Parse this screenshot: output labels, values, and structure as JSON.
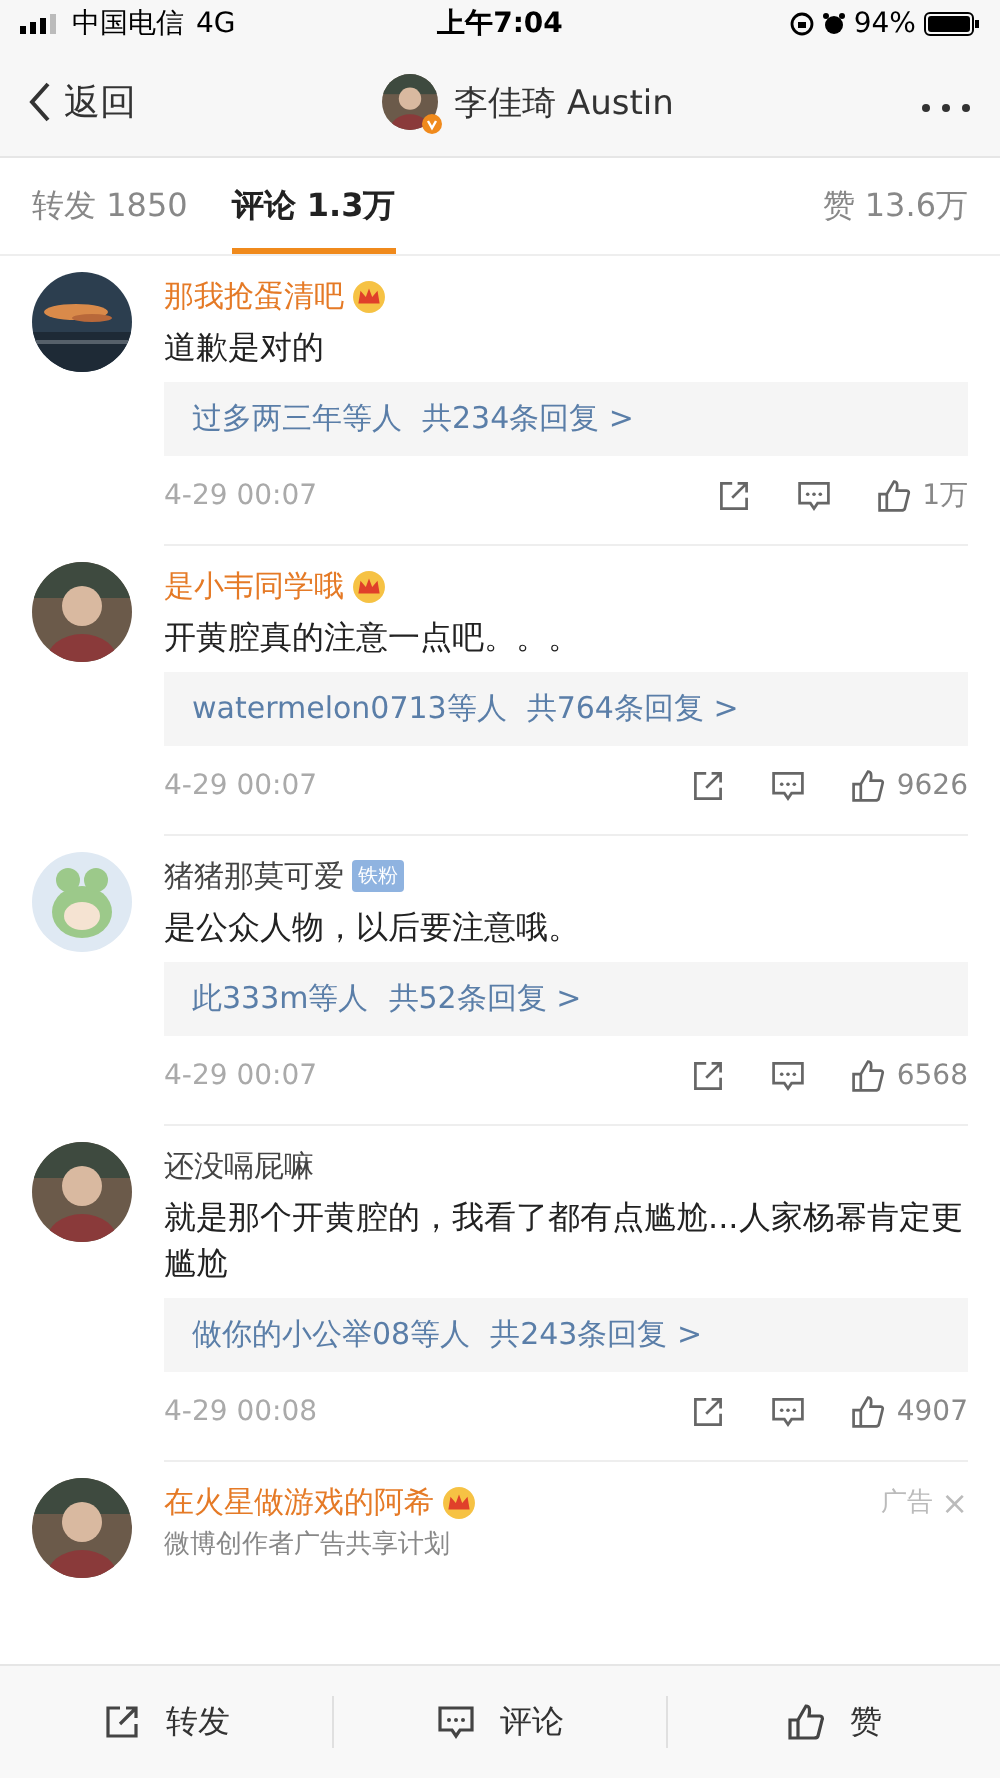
{
  "status_bar": {
    "carrier": "中国电信",
    "network": "4G",
    "time": "上午7:04",
    "battery": "94%"
  },
  "nav": {
    "back": "返回",
    "title": "李佳琦 Austin",
    "verified": true
  },
  "tabs": [
    {
      "label": "转发 1850",
      "selected": false
    },
    {
      "label": "评论 1.3万",
      "selected": true
    },
    {
      "label": "赞 13.6万",
      "selected": false
    }
  ],
  "comments": [
    {
      "name": "那我抢蛋清吧",
      "vip": true,
      "badge": {
        "kind": "crown"
      },
      "avatar": {
        "kind": "sunset"
      },
      "text": "道歉是对的",
      "replies": {
        "who": "过多两三年等人",
        "count": "共234条回复 >"
      },
      "time": "4-29 00:07",
      "likes": "1万"
    },
    {
      "name": "是小韦同学哦",
      "vip": true,
      "badge": {
        "kind": "crown"
      },
      "avatar": {
        "kind": "figure"
      },
      "text": "开黄腔真的注意一点吧。。。",
      "replies": {
        "who": "watermelon0713等人",
        "count": "共764条回复 >"
      },
      "time": "4-29 00:07",
      "likes": "9626"
    },
    {
      "name": "猪猪那莫可爱",
      "vip": false,
      "badge": {
        "kind": "fan",
        "label": "铁粉"
      },
      "avatar": {
        "kind": "cartoon"
      },
      "text": "是公众人物，以后要注意哦。",
      "replies": {
        "who": "此333m等人",
        "count": "共52条回复 >"
      },
      "time": "4-29 00:07",
      "likes": "6568"
    },
    {
      "name": "还没嗝屁嘛",
      "vip": false,
      "avatar": {
        "kind": "figure"
      },
      "text": "就是那个开黄腔的，我看了都有点尴尬...人家杨幂肯定更尴尬",
      "replies": {
        "who": "做你的小公举08等人",
        "count": "共243条回复 >"
      },
      "time": "4-29 00:08",
      "likes": "4907"
    }
  ],
  "ad": {
    "name": "在火星做游戏的阿希",
    "vip": true,
    "badge": {
      "kind": "crown"
    },
    "subtitle": "微博创作者广告共享计划",
    "tag": "广告",
    "close": "×"
  },
  "toolbar": [
    {
      "kind": "share",
      "label": "转发"
    },
    {
      "kind": "comment",
      "label": "评论"
    },
    {
      "kind": "like",
      "label": "赞"
    }
  ]
}
